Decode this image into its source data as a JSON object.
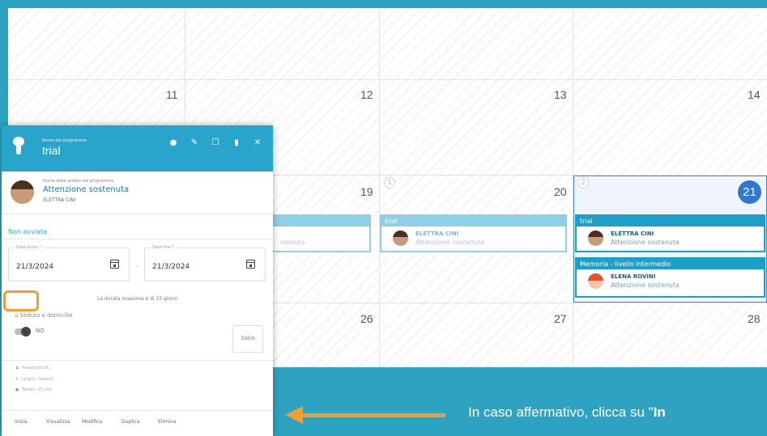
{
  "calendar": {
    "days_row1": [
      "11",
      "12",
      "13",
      "14"
    ],
    "days_row2": [
      "19",
      "20",
      "21"
    ],
    "days_row3": [
      "26",
      "27",
      "28"
    ],
    "event_counts": [
      "1",
      "2"
    ],
    "events": [
      {
        "title": "",
        "name": "",
        "sub": "stenuta"
      },
      {
        "title": "trial",
        "name": "ELETTRA CINI",
        "sub": "Attenzione sostenuta"
      },
      {
        "title": "trial",
        "name": "ELETTRA CINI",
        "sub": "Attenzione sostenuta"
      },
      {
        "title": "Memoria - livello intermedio",
        "name": "ELENA ROVINI",
        "sub": "Attenzione sostenuta"
      }
    ]
  },
  "panel": {
    "program_label": "Nome del programma",
    "program_title": "trial",
    "header_icons": [
      "eye-icon",
      "pencil-icon",
      "copy-icon",
      "trash-icon",
      "close-icon"
    ],
    "session_label": "Nome della seduta del programma",
    "session_name": "Attenzione sostenuta",
    "session_user": "ELETTRA CINI",
    "status": "Non avviata",
    "start_label": "Data Inizio *",
    "start_value": "21/3/2024",
    "end_label": "Data fine *",
    "end_value": "21/3/2024",
    "dash": "-",
    "max_duration": "La durata massima è di 15 giorni",
    "home_session_label": "Seduta a domicilio",
    "toggle_label": "NO",
    "save_label": "Salva",
    "info": [
      "Preagnello BL",
      "Lingua: Italiano",
      "Tempo: 25 min"
    ],
    "actions": [
      "Inizia",
      "Visualizza",
      "Modifica",
      "Duplica",
      "Elimina"
    ]
  },
  "caption": {
    "text": "In caso affermativo, clicca su \"",
    "bold": "In"
  },
  "colors": {
    "background": "#2ea3c1",
    "accent": "#29a5cc",
    "highlight": "#f29d2c",
    "today": "#2e78d2"
  }
}
